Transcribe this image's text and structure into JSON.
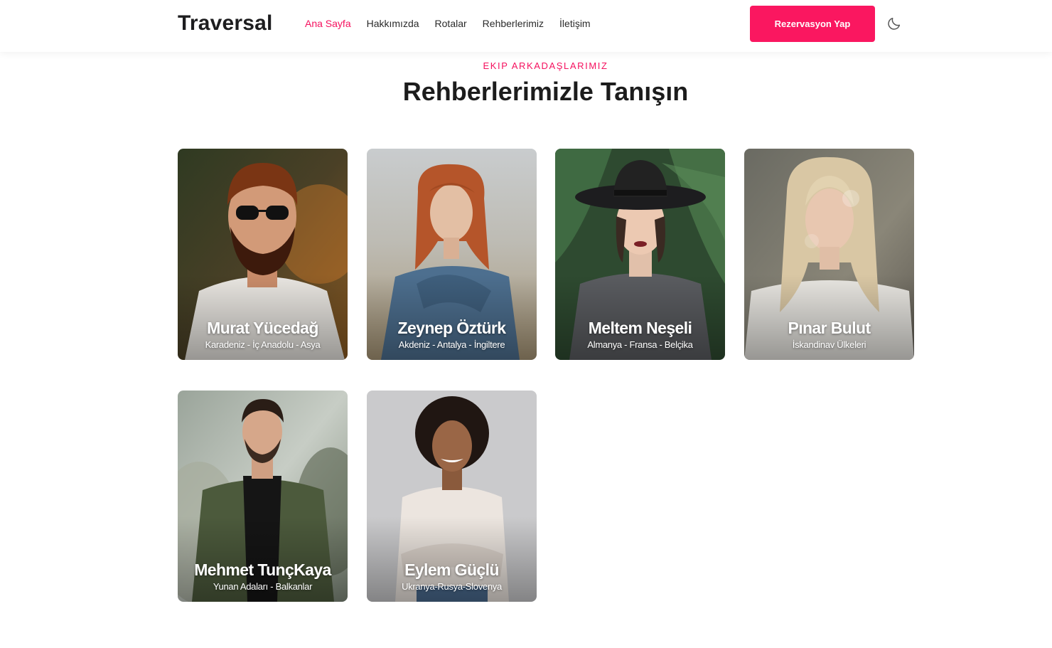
{
  "header": {
    "brand": "Traversal",
    "nav": [
      {
        "label": "Ana Sayfa",
        "active": true
      },
      {
        "label": "Hakkımızda",
        "active": false
      },
      {
        "label": "Rotalar",
        "active": false
      },
      {
        "label": "Rehberlerimiz",
        "active": false
      },
      {
        "label": "İletişim",
        "active": false
      }
    ],
    "cta_label": "Rezervasyon Yap",
    "theme_icon": "moon-icon"
  },
  "section": {
    "eyebrow": "EKIP ARKADAŞLARIMIZ",
    "title": "Rehberlerimizle Tanışın"
  },
  "guides": [
    {
      "name": "Murat Yücedağ",
      "regions": "Karadeniz - İç Anadolu - Asya"
    },
    {
      "name": "Zeynep Öztürk",
      "regions": "Akdeniz - Antalya - İngiltere"
    },
    {
      "name": "Meltem Neşeli",
      "regions": "Almanya - Fransa - Belçika"
    },
    {
      "name": "Pınar Bulut",
      "regions": "İskandinav Ülkeleri"
    },
    {
      "name": "Mehmet TunçKaya",
      "regions": "Yunan Adaları - Balkanlar"
    },
    {
      "name": "Eylem Güçlü",
      "regions": "Ukranya-Rusya-Slovenya"
    }
  ],
  "colors": {
    "accent": "#fa1760",
    "active_link": "#f5105e",
    "text": "#1c1c1c"
  }
}
